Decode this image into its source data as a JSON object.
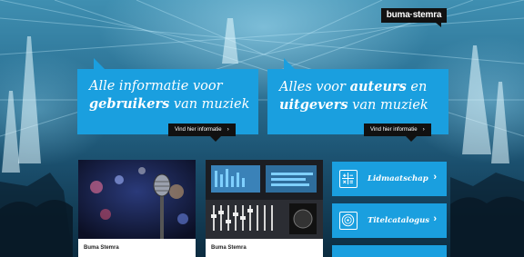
{
  "header": {
    "logo_text": "buma·stemra"
  },
  "promos": [
    {
      "line1_pre": "Alle informatie voor",
      "line2_bold": "gebruikers",
      "line2_post": " van muziek",
      "button_label": "Vind hier informatie"
    },
    {
      "line1_pre": "Alles voor ",
      "line1_bold": "auteurs",
      "line1_post": " en",
      "line2_bold": "uitgevers",
      "line2_post": " van muziek",
      "button_label": "Vind hier informatie"
    }
  ],
  "cards": [
    {
      "label": "Buma Stemra"
    },
    {
      "label": "Buma Stemra"
    }
  ],
  "tiles": [
    {
      "label": "Lidmaatschap",
      "icon": "calculator-icon"
    },
    {
      "label": "Titelcatalogus",
      "icon": "vinyl-record-icon"
    },
    {
      "label": "",
      "icon": ""
    }
  ],
  "colors": {
    "accent_blue": "#1a9fdf",
    "black": "#111111"
  }
}
